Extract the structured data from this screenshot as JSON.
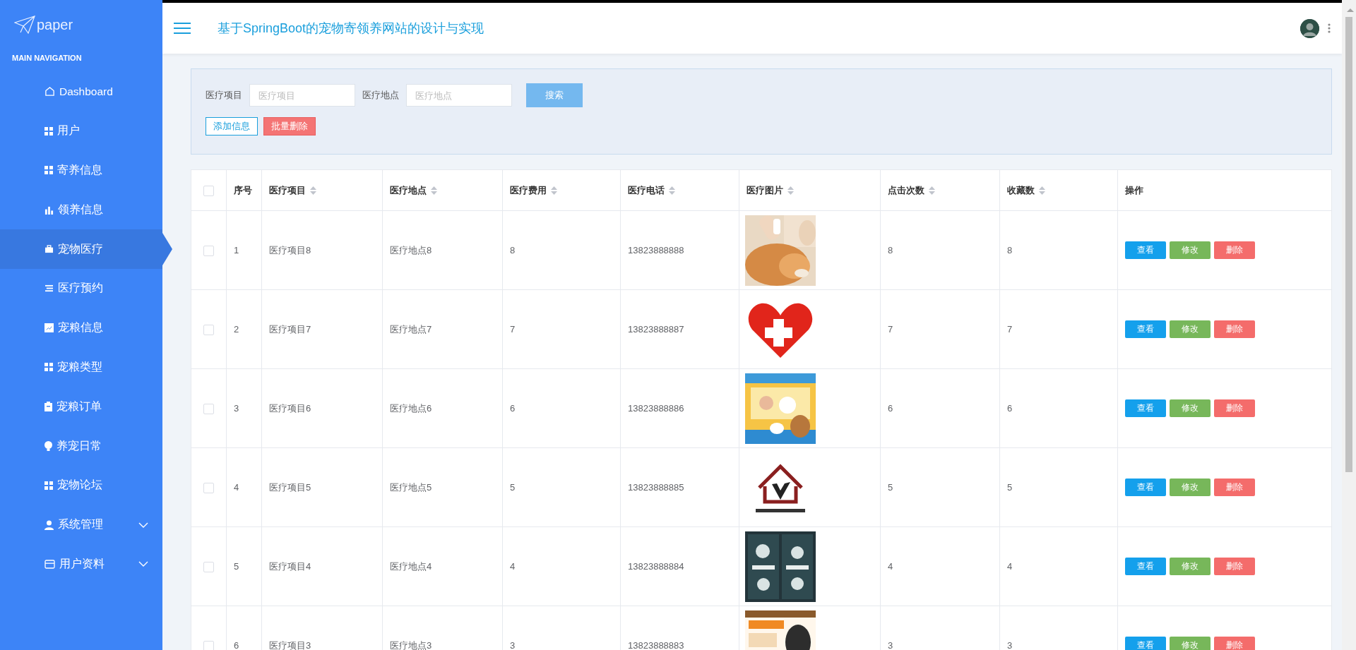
{
  "sidebar": {
    "logo": "paper",
    "section_title": "MAIN NAVIGATION",
    "items": [
      {
        "label": "Dashboard",
        "selected": false,
        "kind": "link"
      },
      {
        "label": "用户",
        "selected": false,
        "kind": "link"
      },
      {
        "label": "寄养信息",
        "selected": false,
        "kind": "link"
      },
      {
        "label": "领养信息",
        "selected": false,
        "kind": "link"
      },
      {
        "label": "宠物医疗",
        "selected": true,
        "kind": "link"
      },
      {
        "label": "医疗预约",
        "selected": false,
        "kind": "link"
      },
      {
        "label": "宠粮信息",
        "selected": false,
        "kind": "link"
      },
      {
        "label": "宠粮类型",
        "selected": false,
        "kind": "link"
      },
      {
        "label": "宠粮订单",
        "selected": false,
        "kind": "link"
      },
      {
        "label": "养宠日常",
        "selected": false,
        "kind": "link"
      },
      {
        "label": "宠物论坛",
        "selected": false,
        "kind": "link"
      },
      {
        "label": "系统管理",
        "selected": false,
        "kind": "submenu"
      },
      {
        "label": "用户资料",
        "selected": false,
        "kind": "submenu"
      }
    ]
  },
  "header": {
    "title": "基于SpringBoot的宠物寄领养网站的设计与实现"
  },
  "search": {
    "fields": [
      {
        "label": "医疗项目",
        "placeholder": "医疗项目"
      },
      {
        "label": "医疗地点",
        "placeholder": "医疗地点"
      }
    ],
    "search_button": "搜索",
    "add_button": "添加信息",
    "batch_delete_button": "批量删除"
  },
  "table": {
    "select_all_checked": false,
    "columns": [
      {
        "label": "序号",
        "sortable": false,
        "kind": "text"
      },
      {
        "label": "医疗项目",
        "sortable": true,
        "kind": "text"
      },
      {
        "label": "医疗地点",
        "sortable": true,
        "kind": "text"
      },
      {
        "label": "医疗费用",
        "sortable": true,
        "kind": "text"
      },
      {
        "label": "医疗电话",
        "sortable": true,
        "kind": "text"
      },
      {
        "label": "医疗图片",
        "sortable": true
      },
      {
        "label": "点击次数",
        "sortable": true,
        "kind": "text"
      },
      {
        "label": "收藏数",
        "sortable": true,
        "kind": "text"
      },
      {
        "label": "操作",
        "sortable": false,
        "kind": "actions"
      }
    ],
    "rows": [
      {
        "checked": false,
        "cells": [
          "1",
          "医疗项目8",
          "医疗地点8",
          "8",
          "13823888888",
          {
            "kind": "picture"
          },
          "8",
          "8",
          [
            {
              "label": "查看",
              "kind": "view"
            },
            {
              "label": "修改",
              "kind": "edit"
            },
            {
              "label": "删除",
              "kind": "delete"
            }
          ]
        ]
      },
      {
        "checked": false,
        "cells": [
          "2",
          "医疗项目7",
          "医疗地点7",
          "7",
          "13823888887",
          {
            "kind": "picture"
          },
          "7",
          "7",
          [
            {
              "label": "查看",
              "kind": "view"
            },
            {
              "label": "修改",
              "kind": "edit"
            },
            {
              "label": "删除",
              "kind": "delete"
            }
          ]
        ]
      },
      {
        "checked": false,
        "cells": [
          "3",
          "医疗项目6",
          "医疗地点6",
          "6",
          "13823888886",
          {
            "kind": "picture"
          },
          "6",
          "6",
          [
            {
              "label": "查看",
              "kind": "view"
            },
            {
              "label": "修改",
              "kind": "edit"
            },
            {
              "label": "删除",
              "kind": "delete"
            }
          ]
        ]
      },
      {
        "checked": false,
        "cells": [
          "4",
          "医疗项目5",
          "医疗地点5",
          "5",
          "13823888885",
          {
            "kind": "picture"
          },
          "5",
          "5",
          [
            {
              "label": "查看",
              "kind": "view"
            },
            {
              "label": "修改",
              "kind": "edit"
            },
            {
              "label": "删除",
              "kind": "delete"
            }
          ]
        ]
      },
      {
        "checked": false,
        "cells": [
          "5",
          "医疗项目4",
          "医疗地点4",
          "4",
          "13823888884",
          {
            "kind": "picture"
          },
          "4",
          "4",
          [
            {
              "label": "查看",
              "kind": "view"
            },
            {
              "label": "修改",
              "kind": "edit"
            },
            {
              "label": "删除",
              "kind": "delete"
            }
          ]
        ]
      },
      {
        "checked": false,
        "cells": [
          "6",
          "医疗项目3",
          "医疗地点3",
          "3",
          "13823888883",
          {
            "kind": "picture"
          },
          "3",
          "3",
          [
            {
              "label": "查看",
              "kind": "view"
            },
            {
              "label": "修改",
              "kind": "edit"
            },
            {
              "label": "删除",
              "kind": "delete"
            }
          ]
        ]
      }
    ]
  }
}
